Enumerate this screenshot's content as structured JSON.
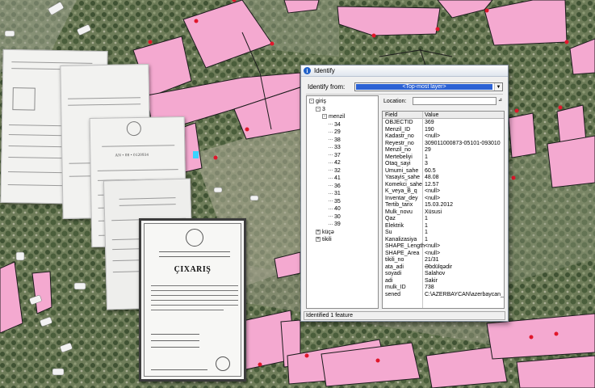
{
  "window": {
    "title": "Identify",
    "identify_from_label": "Identify from:",
    "identify_from_value": "<Top-most layer>",
    "location_label": "Location:",
    "status": "Identified 1 feature"
  },
  "tree": [
    {
      "label": "giriş",
      "level": 0,
      "toggle": "-"
    },
    {
      "label": "3",
      "level": 1,
      "toggle": "-"
    },
    {
      "label": "menzil",
      "level": 2,
      "toggle": "-"
    },
    {
      "label": "34",
      "level": 3
    },
    {
      "label": "29",
      "level": 3
    },
    {
      "label": "38",
      "level": 3
    },
    {
      "label": "33",
      "level": 3
    },
    {
      "label": "37",
      "level": 3
    },
    {
      "label": "42",
      "level": 3
    },
    {
      "label": "32",
      "level": 3
    },
    {
      "label": "41",
      "level": 3
    },
    {
      "label": "36",
      "level": 3
    },
    {
      "label": "31",
      "level": 3
    },
    {
      "label": "35",
      "level": 3
    },
    {
      "label": "40",
      "level": 3
    },
    {
      "label": "30",
      "level": 3
    },
    {
      "label": "39",
      "level": 3
    },
    {
      "label": "küçə",
      "level": 1,
      "toggle": "+"
    },
    {
      "label": "tikili",
      "level": 1,
      "toggle": "+"
    }
  ],
  "table": {
    "headers": [
      "Field",
      "Value"
    ],
    "rows": [
      [
        "OBJECTID",
        "369"
      ],
      [
        "Menzil_ID",
        "190"
      ],
      [
        "Kadastr_no",
        "<null>"
      ],
      [
        "Reyestr_no",
        "309011000873-05101-093010"
      ],
      [
        "Menzil_no",
        "29"
      ],
      [
        "Mertebeliyi",
        "1"
      ],
      [
        "Otaq_sayi",
        "3"
      ],
      [
        "Umumi_sahe",
        "60.5"
      ],
      [
        "Yasayis_sahe",
        "48.08"
      ],
      [
        "Komekci_sahe",
        "12.57"
      ],
      [
        "K_veya_B_q",
        "<null>"
      ],
      [
        "Inventar_dey",
        "<null>"
      ],
      [
        "Tertib_tarix",
        "15.03.2012"
      ],
      [
        "Mulk_novu",
        "Xüsusi"
      ],
      [
        "Qaz",
        "1"
      ],
      [
        "Elektrik",
        "1"
      ],
      [
        "Su",
        "1"
      ],
      [
        "Kanalizasiya",
        "1"
      ],
      [
        "SHAPE_Length",
        "<null>"
      ],
      [
        "SHAPE_Area",
        "<null>"
      ],
      [
        "tikili_no",
        "21/31"
      ],
      [
        "ata_adi",
        "Əbdülqədir"
      ],
      [
        "soyadi",
        "Salahov"
      ],
      [
        "adi",
        "Sakir"
      ],
      [
        "mulk_ID",
        "738"
      ],
      [
        "sened",
        "C:\\AZERBAYCAN\\azerbaycan_sur"
      ]
    ]
  },
  "documents": {
    "cert_title": "ÇIXARIŞ",
    "doc3_heading": "AN • 08 • 0120934"
  },
  "colors": {
    "parcel_fill": "#f4a9d0",
    "parcel_stroke": "#1b1b1b",
    "vertex": "#e0162b",
    "selection_highlight": "#2c62d4",
    "map_ground": "#7f8d6c"
  }
}
